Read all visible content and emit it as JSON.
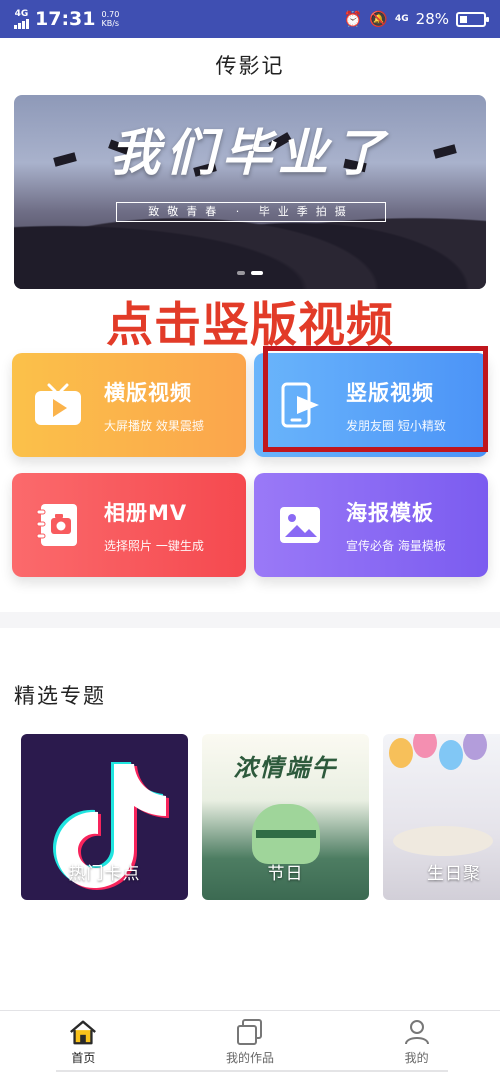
{
  "status_bar": {
    "network": "4G",
    "time": "17:31",
    "speed_value": "0.70",
    "speed_unit": "KB/s",
    "network_right": "4G",
    "battery": "28%"
  },
  "app": {
    "title": "传影记"
  },
  "banner": {
    "headline": "我们毕业了",
    "subline": "致敬青春 · 毕业季拍摄",
    "dots": 2,
    "active_dot": 1
  },
  "annotation": "点击竖版视频",
  "features": [
    {
      "title": "横版视频",
      "subtitle": "大屏播放 效果震撼",
      "icon": "tv-icon",
      "color": "#fbb34b"
    },
    {
      "title": "竖版视频",
      "subtitle": "发朋友圈 短小精致",
      "icon": "phone-video-icon",
      "color": "#5aa5f9"
    },
    {
      "title": "相册MV",
      "subtitle": "选择照片 一键生成",
      "icon": "album-icon",
      "color": "#f85b5e"
    },
    {
      "title": "海报模板",
      "subtitle": "宣传必备 海量模板",
      "icon": "image-icon",
      "color": "#8a6af4"
    }
  ],
  "section": {
    "title": "精选专题"
  },
  "topics": [
    {
      "label": "热门卡点"
    },
    {
      "label": "节日",
      "poster_text": "浓情端午"
    },
    {
      "label": "生日聚"
    }
  ],
  "bottom_nav": [
    {
      "label": "首页",
      "icon": "home-icon",
      "active": true
    },
    {
      "label": "我的作品",
      "icon": "works-icon",
      "active": false
    },
    {
      "label": "我的",
      "icon": "profile-icon",
      "active": false
    }
  ]
}
